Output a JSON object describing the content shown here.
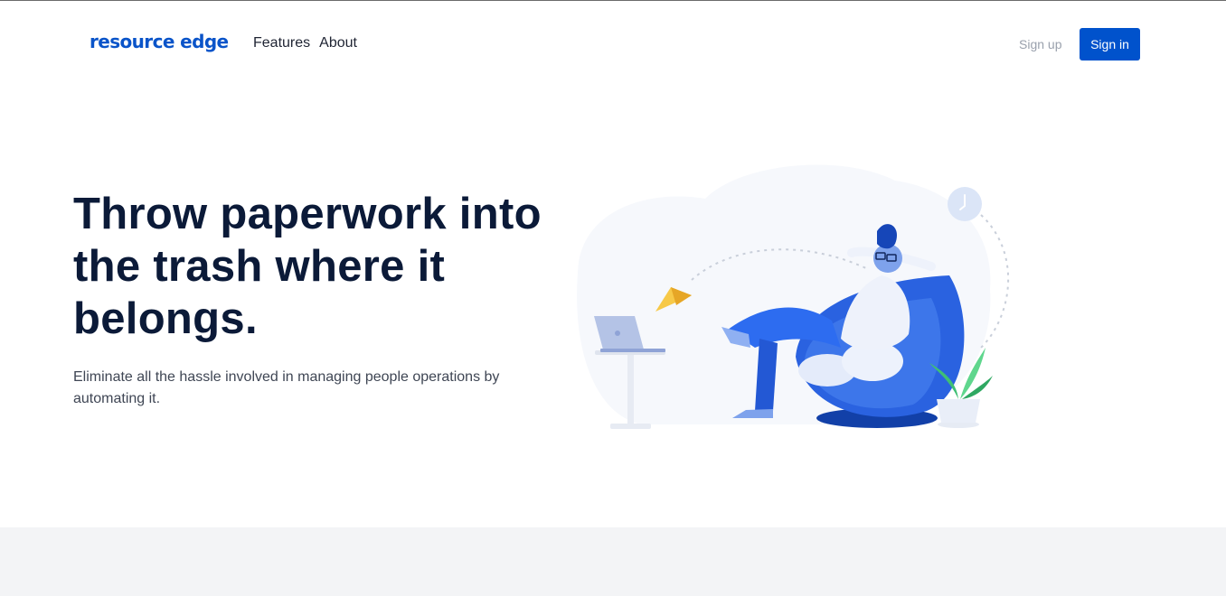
{
  "header": {
    "logo_text": "resource edge",
    "nav": [
      {
        "label": "Features"
      },
      {
        "label": "About"
      }
    ],
    "signup_label": "Sign up",
    "signin_label": "Sign in"
  },
  "hero": {
    "title": "Throw paperwork into the trash where it belongs.",
    "subtitle": "Eliminate all the hassle involved in managing people operations by automating it."
  },
  "colors": {
    "brand": "#0052cc",
    "heading": "#0b1a38",
    "footer_band": "#f3f4f6"
  },
  "icons": {
    "hero_illustration": "person-relaxing-in-beanbag-illustration"
  }
}
